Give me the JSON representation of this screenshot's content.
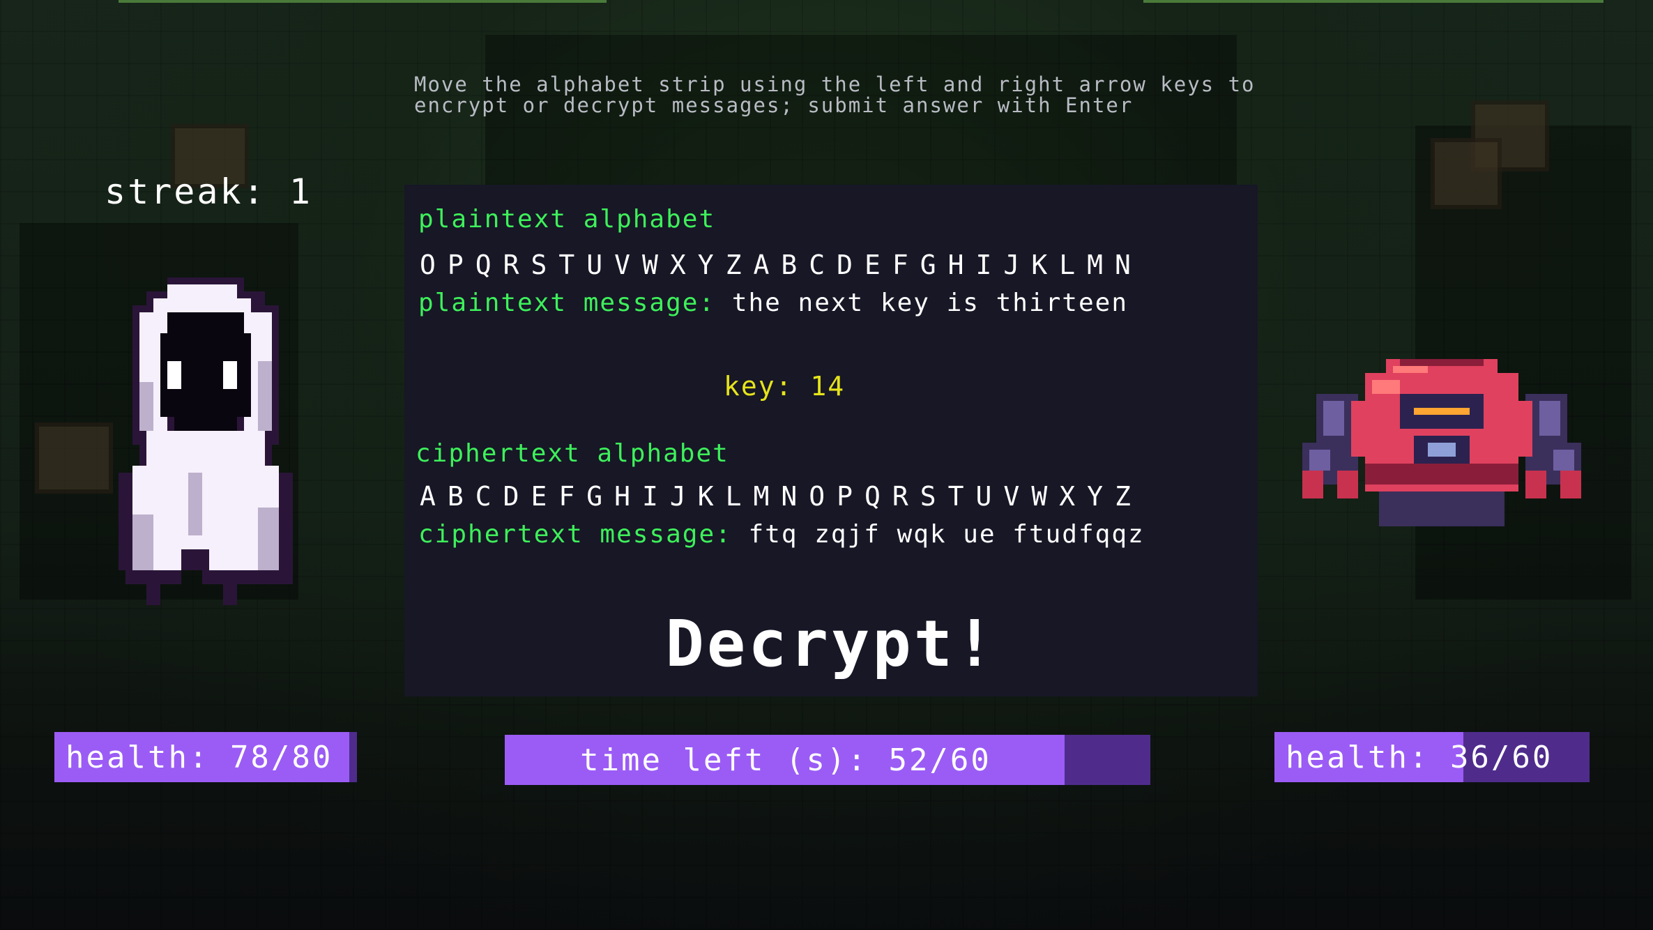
{
  "instructions": "Move the alphabet strip using the left and right arrow keys to\nencrypt or decrypt messages; submit answer with Enter",
  "streak": {
    "label": "streak:",
    "value": "1"
  },
  "panel": {
    "plaintext_alphabet_label": "plaintext alphabet",
    "plaintext_alphabet": "OPQRSTUVWXYZABCDEFGHIJKLMN",
    "plaintext_message_label": "plaintext message:",
    "plaintext_message": "the next key is thirteen",
    "key_label": "key:",
    "key_value": "14",
    "ciphertext_alphabet_label": "ciphertext alphabet",
    "ciphertext_alphabet": "ABCDEFGHIJKLMNOPQRSTUVWXYZ",
    "ciphertext_message_label": "ciphertext message:",
    "ciphertext_message": "ftq zqjf wqk ue ftudfqqz",
    "action": "Decrypt!"
  },
  "player_health": {
    "label": "health:",
    "current": 78,
    "max": 80,
    "text": "78/80"
  },
  "timer": {
    "label": "time left (s):",
    "current": 52,
    "max": 60,
    "text": "52/60"
  },
  "enemy_health": {
    "label": "health:",
    "current": 36,
    "max": 60,
    "text": "36/60"
  },
  "colors": {
    "accent_green": "#3ef05a",
    "key_yellow": "#e6e41a",
    "bar_fill": "#9b5cf5",
    "bar_empty": "#4f2c8c",
    "panel_bg": "#171726"
  },
  "sprites": {
    "player": "hooded-ghost",
    "enemy": "red-robot"
  }
}
